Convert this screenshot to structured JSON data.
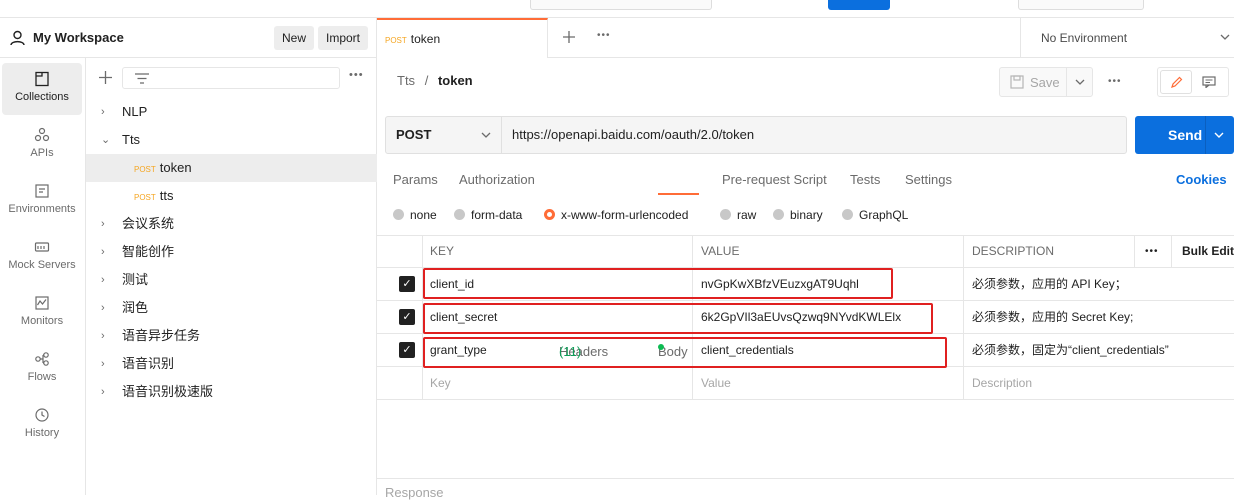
{
  "workspace": {
    "title": "My Workspace",
    "new_label": "New",
    "import_label": "Import"
  },
  "rail": [
    {
      "label": "Collections",
      "icon": "collections-icon"
    },
    {
      "label": "APIs",
      "icon": "apis-icon"
    },
    {
      "label": "Environments",
      "icon": "environments-icon"
    },
    {
      "label": "Mock Servers",
      "icon": "mock-servers-icon"
    },
    {
      "label": "Monitors",
      "icon": "monitors-icon"
    },
    {
      "label": "Flows",
      "icon": "flows-icon"
    },
    {
      "label": "History",
      "icon": "history-icon"
    }
  ],
  "tree": {
    "items": [
      {
        "label": "NLP",
        "chev": "›"
      },
      {
        "label": "Tts",
        "chev": "⌄"
      },
      {
        "label": "token",
        "method": "POST"
      },
      {
        "label": "tts",
        "method": "POST"
      },
      {
        "label": "会议系统",
        "chev": "›"
      },
      {
        "label": "智能创作",
        "chev": "›"
      },
      {
        "label": "测试",
        "chev": "›"
      },
      {
        "label": "润色",
        "chev": "›"
      },
      {
        "label": "语音异步任务",
        "chev": "›"
      },
      {
        "label": "语音识别",
        "chev": "›"
      },
      {
        "label": "语音识别极速版",
        "chev": "›"
      }
    ]
  },
  "tab": {
    "method": "POST",
    "name": "token"
  },
  "environment": "No Environment",
  "breadcrumb": {
    "parent": "Tts",
    "sep": "/",
    "current": "token"
  },
  "toolbar": {
    "save_label": "Save"
  },
  "request": {
    "method": "POST",
    "url": "https://openapi.baidu.com/oauth/2.0/token",
    "send_label": "Send"
  },
  "request_tabs": {
    "params": "Params",
    "authorization": "Authorization",
    "headers": "Headers",
    "headers_count": "(11)",
    "body": "Body",
    "pre_request": "Pre-request Script",
    "tests": "Tests",
    "settings": "Settings",
    "cookies": "Cookies"
  },
  "body_types": {
    "none": "none",
    "form_data": "form-data",
    "urlencoded": "x-www-form-urlencoded",
    "raw": "raw",
    "binary": "binary",
    "graphql": "GraphQL"
  },
  "table": {
    "headers": {
      "key": "KEY",
      "value": "VALUE",
      "description": "DESCRIPTION",
      "more": "•••",
      "bulk_edit": "Bulk Edit"
    },
    "rows": [
      {
        "key": "client_id",
        "value": "nvGpKwXBfzVEuzxgAT9Uqhl",
        "description": "必须参数，应用的 API Key；"
      },
      {
        "key": "client_secret",
        "value": "6k2GpVIl3aEUvsQzwq9NYvdKWLElx",
        "description": "必须参数，应用的 Secret Key;"
      },
      {
        "key": "grant_type",
        "value": "client_credentials",
        "description": "必须参数，固定为“client_credentials”"
      }
    ],
    "placeholders": {
      "key": "Key",
      "value": "Value",
      "description": "Description"
    }
  },
  "response_label": "Response",
  "accent": "#ff6c37",
  "primary": "#0b6fde"
}
